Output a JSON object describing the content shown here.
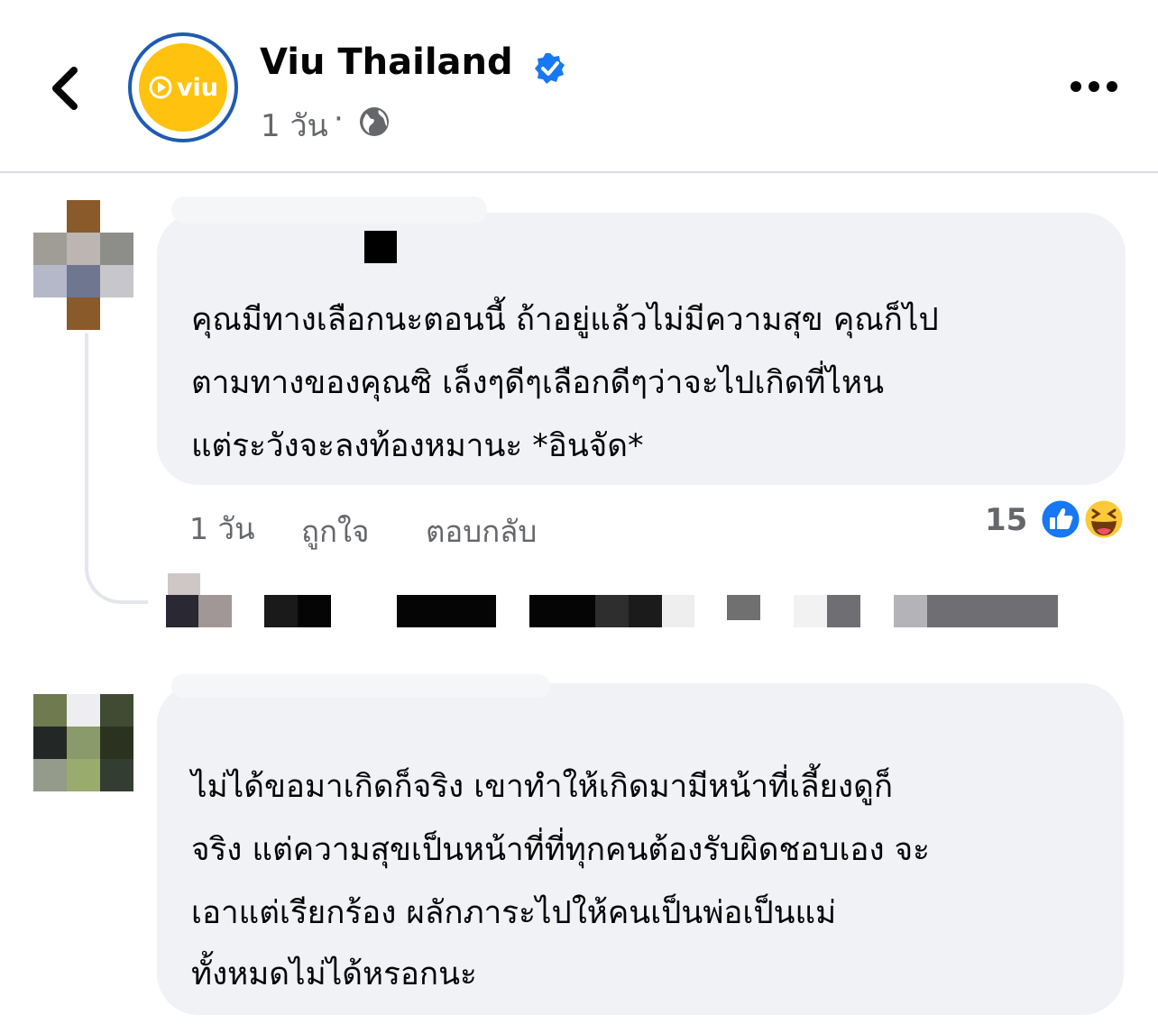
{
  "header": {
    "page_name": "Viu Thailand",
    "logo_text": "viu",
    "post_time": "1 วัน",
    "separator": "·",
    "icons": {
      "back": "chevron-left-icon",
      "verified": "verified-badge-icon",
      "audience": "globe-icon",
      "more": "more-horizontal-icon"
    },
    "verified_color": "#1877f2",
    "logo_color": "#ffc20e"
  },
  "comments": [
    {
      "lines": [
        "คุณมีทางเลือกนะตอนนี้ ถ้าอยู่แล้วไม่มีความสุข คุณก็ไป",
        "ตามทางของคุณซิ เล็งๆดีๆเลือกดีๆว่าจะไปเกิดที่ไหน",
        "แต่ระวังจะลงท้องหมานะ *อินจัด*"
      ],
      "time": "1 วัน",
      "like_label": "ถูกใจ",
      "reply_label": "ตอบกลับ",
      "reaction_count": "15",
      "reactions": [
        "like-reaction-icon",
        "haha-reaction-icon"
      ]
    },
    {
      "lines": [
        "ไม่ได้ขอมาเกิดก็จริง เขาทำให้เกิดมามีหน้าที่เลี้ยงดูก็",
        "จริง แต่ความสุขเป็นหน้าที่ที่ทุกคนต้องรับผิดชอบเอง จะ",
        "เอาแต่เรียกร้อง ผลักภาระไปให้คนเป็นพ่อเป็นแม่",
        "ทั้งหมดไม่ได้หรอกนะ"
      ]
    }
  ]
}
